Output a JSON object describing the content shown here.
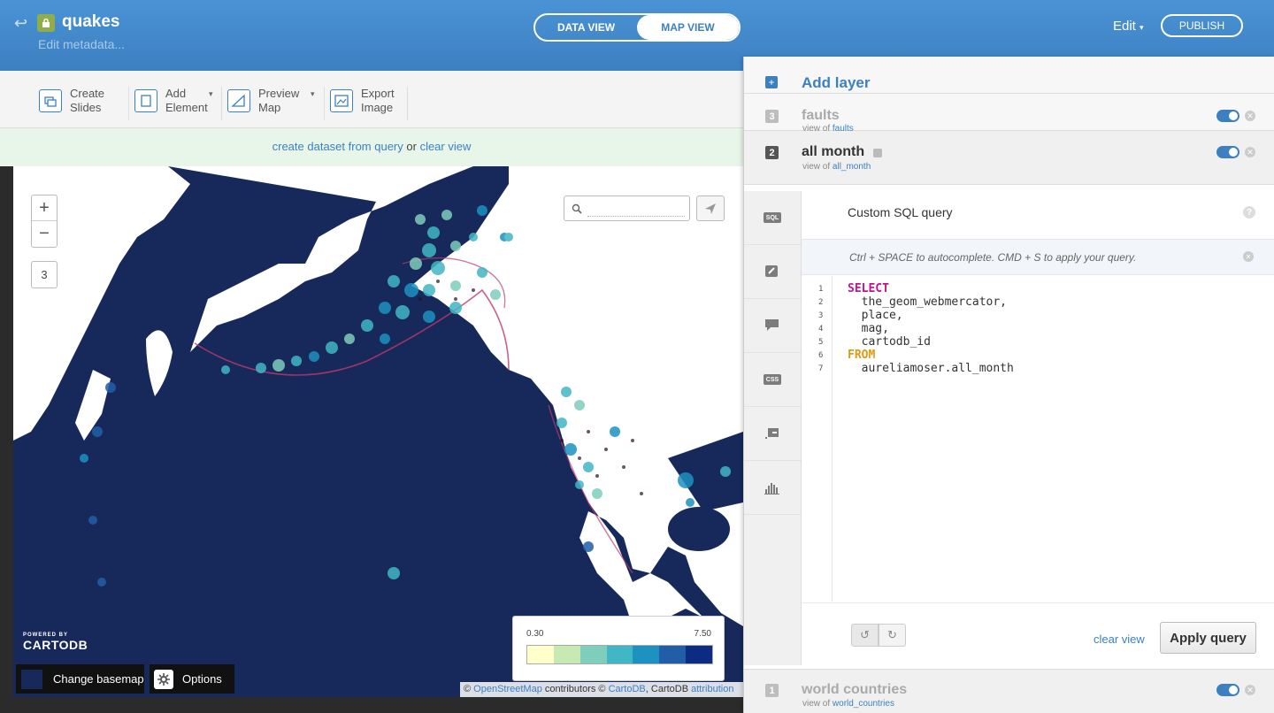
{
  "header": {
    "title": "quakes",
    "edit_metadata": "Edit metadata...",
    "data_view": "DATA VIEW",
    "map_view": "MAP VIEW",
    "edit_menu": "Edit",
    "publish": "PUBLISH"
  },
  "toolbar": {
    "items": [
      {
        "line1": "Create",
        "line2": "Slides"
      },
      {
        "line1": "Add",
        "line2": "Element"
      },
      {
        "line1": "Preview",
        "line2": "Map"
      },
      {
        "line1": "Export",
        "line2": "Image"
      }
    ]
  },
  "infobar": {
    "create_link": "create dataset from query",
    "or": " or ",
    "clear_link": "clear view"
  },
  "map": {
    "zoom_in": "+",
    "zoom_out": "−",
    "zoom_level": "3",
    "legend_min": "0.30",
    "legend_max": "7.50",
    "legend_colors": [
      "#ffffcc",
      "#c7e9b4",
      "#7fcdbb",
      "#41b6c4",
      "#1d91c0",
      "#225ea8",
      "#0c2c84"
    ],
    "powered_by": "POWERED BY",
    "logo": "CARTODB",
    "change_basemap": "Change basemap",
    "options": "Options",
    "attribution_copy1": "© ",
    "attribution_osm": "OpenStreetMap",
    "attribution_mid": " contributors © ",
    "attribution_cartodb": "CartoDB",
    "attribution_tail": ", CartoDB ",
    "attribution_link": "attribution"
  },
  "panel": {
    "add_layer": "Add layer",
    "layers": [
      {
        "num": "3",
        "name": "faults",
        "view_of": "view of",
        "source": "faults"
      },
      {
        "num": "2",
        "name": "all month",
        "view_of": "view of",
        "source": "all_month"
      },
      {
        "num": "1",
        "name": "world countries",
        "view_of": "view of",
        "source": "world_countries"
      }
    ],
    "sql_tab": "SQL",
    "css_tab": "CSS",
    "editor_title": "Custom SQL query",
    "help": "?",
    "hint": "Ctrl + SPACE to autocomplete. CMD + S to apply your query.",
    "code": [
      {
        "n": "1",
        "text": "SELECT"
      },
      {
        "n": "2",
        "text": "  the_geom_webmercator,"
      },
      {
        "n": "3",
        "text": "  place,"
      },
      {
        "n": "4",
        "text": "  mag,"
      },
      {
        "n": "5",
        "text": "  cartodb_id"
      },
      {
        "n": "6",
        "text": "FROM"
      },
      {
        "n": "7",
        "text": "  aureliamoser.all_month"
      }
    ],
    "clear_view": "clear view",
    "apply_query": "Apply query"
  },
  "colors": {
    "accent": "#3d80c2",
    "map_ocean": "#17295b",
    "land": "#ffffff"
  }
}
